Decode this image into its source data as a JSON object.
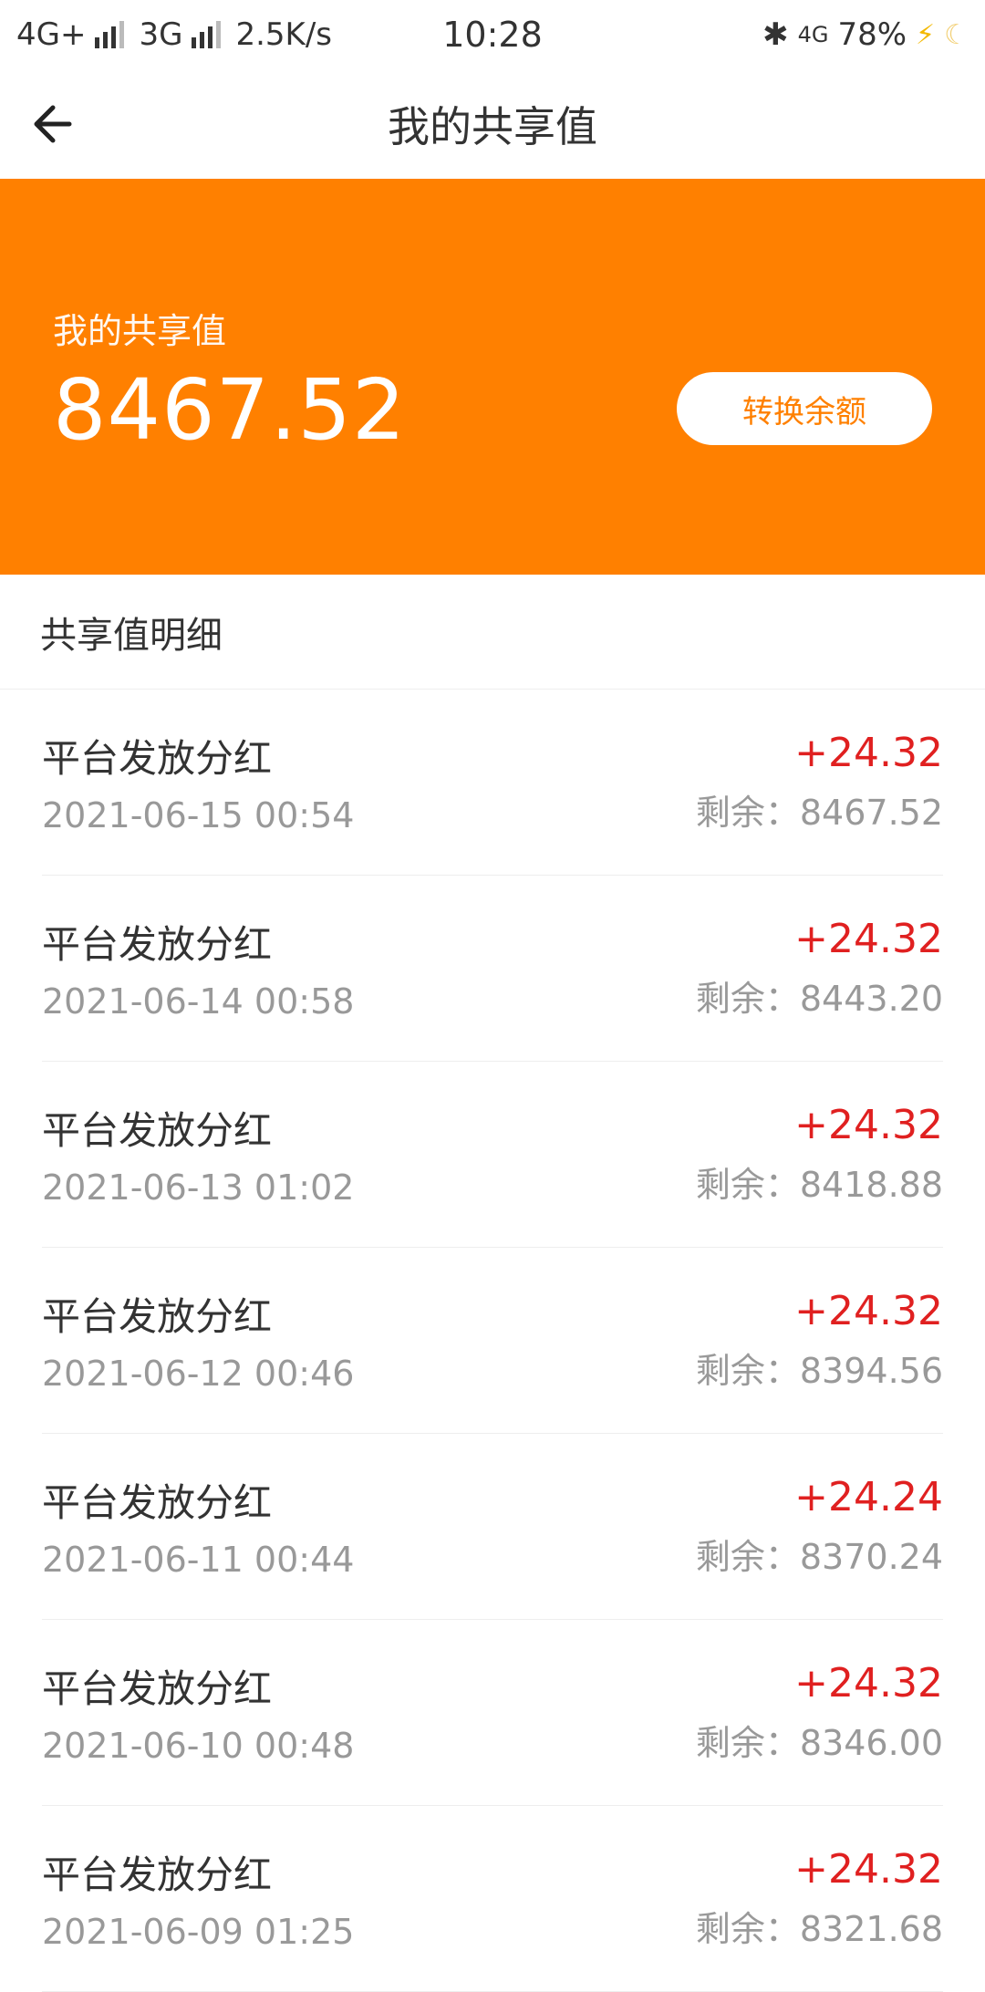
{
  "status_bar": {
    "network1": "4G+",
    "network2": "3G",
    "speed": "2.5K/s",
    "time": "10:28",
    "data_icon": "4G",
    "battery": "78%"
  },
  "header": {
    "title": "我的共享值"
  },
  "summary": {
    "label": "我的共享值",
    "value": "8467.52",
    "convert_label": "转换余额"
  },
  "detail": {
    "section_title": "共享值明细",
    "remain_prefix": "剩余：",
    "items": [
      {
        "title": "平台发放分红",
        "date": "2021-06-15 00:54",
        "amount": "+24.32",
        "remain": "剩余：8467.52"
      },
      {
        "title": "平台发放分红",
        "date": "2021-06-14 00:58",
        "amount": "+24.32",
        "remain": "剩余：8443.20"
      },
      {
        "title": "平台发放分红",
        "date": "2021-06-13 01:02",
        "amount": "+24.32",
        "remain": "剩余：8418.88"
      },
      {
        "title": "平台发放分红",
        "date": "2021-06-12 00:46",
        "amount": "+24.32",
        "remain": "剩余：8394.56"
      },
      {
        "title": "平台发放分红",
        "date": "2021-06-11 00:44",
        "amount": "+24.24",
        "remain": "剩余：8370.24"
      },
      {
        "title": "平台发放分红",
        "date": "2021-06-10 00:48",
        "amount": "+24.32",
        "remain": "剩余：8346.00"
      },
      {
        "title": "平台发放分红",
        "date": "2021-06-09 01:25",
        "amount": "+24.32",
        "remain": "剩余：8321.68"
      }
    ]
  },
  "colors": {
    "accent": "#ff8000",
    "positive": "#e02020",
    "muted": "#999999"
  },
  "icons": {
    "back": "arrow-left-icon",
    "bluetooth": "bluetooth-icon",
    "charging": "charging-icon",
    "night_mode": "moon-icon"
  }
}
